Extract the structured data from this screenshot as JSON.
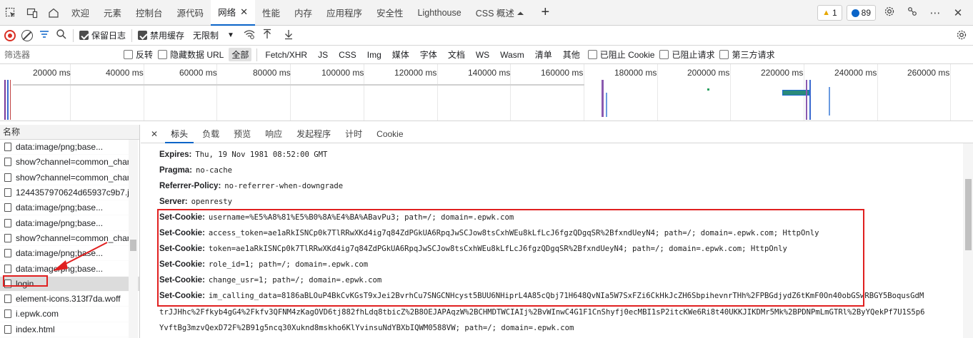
{
  "tabs": {
    "items": [
      {
        "label": "欢迎"
      },
      {
        "label": "元素"
      },
      {
        "label": "控制台"
      },
      {
        "label": "源代码"
      },
      {
        "label": "网络"
      },
      {
        "label": "性能"
      },
      {
        "label": "内存"
      },
      {
        "label": "应用程序"
      },
      {
        "label": "安全性"
      },
      {
        "label": "Lighthouse"
      },
      {
        "label": "CSS 概述 ⏶"
      }
    ],
    "active": "网络",
    "close_glyph": "✕",
    "plus_glyph": "+",
    "warnings": "1",
    "issues": "89"
  },
  "toolbar": {
    "preserve_log": "保留日志",
    "disable_cache": "禁用缓存",
    "throttle": "无限制"
  },
  "filter": {
    "placeholder": "筛选器",
    "invert": "反转",
    "hide_data_urls": "隐藏数据 URL",
    "types": [
      "全部",
      "Fetch/XHR",
      "JS",
      "CSS",
      "Img",
      "媒体",
      "字体",
      "文档",
      "WS",
      "Wasm",
      "清单",
      "其他"
    ],
    "blocked_cookies": "已阻止 Cookie",
    "blocked_requests": "已阻止请求",
    "third_party": "第三方请求"
  },
  "timeline": {
    "ticks": [
      "20000 ms",
      "40000 ms",
      "60000 ms",
      "80000 ms",
      "100000 ms",
      "120000 ms",
      "140000 ms",
      "160000 ms",
      "180000 ms",
      "200000 ms",
      "220000 ms",
      "240000 ms",
      "260000 ms"
    ]
  },
  "requests": {
    "header": "名称",
    "items": [
      {
        "name": "data:image/png;base..."
      },
      {
        "name": "show?channel=common_char"
      },
      {
        "name": "show?channel=common_char"
      },
      {
        "name": "1244357970624d65937c9b7.jp"
      },
      {
        "name": "data:image/png;base..."
      },
      {
        "name": "data:image/png;base..."
      },
      {
        "name": "show?channel=common_char"
      },
      {
        "name": "data:image/png;base..."
      },
      {
        "name": "data:image/png;base..."
      },
      {
        "name": "login"
      },
      {
        "name": "element-icons.313f7da.woff"
      },
      {
        "name": "i.epwk.com"
      },
      {
        "name": "index.html"
      }
    ]
  },
  "detail": {
    "tabs": [
      "标头",
      "负载",
      "预览",
      "响应",
      "发起程序",
      "计时",
      "Cookie"
    ],
    "active_tab": "标头",
    "headers": [
      {
        "name": "Expires:",
        "value": "Thu, 19 Nov 1981 08:52:00 GMT"
      },
      {
        "name": "Pragma:",
        "value": "no-cache"
      },
      {
        "name": "Referrer-Policy:",
        "value": "no-referrer-when-downgrade"
      },
      {
        "name": "Server:",
        "value": "openresty"
      },
      {
        "name": "Set-Cookie:",
        "value": "username=%E5%A8%81%E5%B0%8A%E4%BA%ABavPu3; path=/; domain=.epwk.com"
      },
      {
        "name": "Set-Cookie:",
        "value": "access_token=ae1aRkISNCp0k7TlRRwXKd4ig7q84ZdPGkUA6RpqJwSCJow8tsCxhWEu8kLfLcJ6fgzQDgqSR%2BfxndUeyN4; path=/; domain=.epwk.com; HttpOnly"
      },
      {
        "name": "Set-Cookie:",
        "value": "token=ae1aRkISNCp0k7TlRRwXKd4ig7q84ZdPGkUA6RpqJwSCJow8tsCxhWEu8kLfLcJ6fgzQDgqSR%2BfxndUeyN4; path=/; domain=.epwk.com; HttpOnly"
      },
      {
        "name": "Set-Cookie:",
        "value": "role_id=1; path=/; domain=.epwk.com"
      },
      {
        "name": "Set-Cookie:",
        "value": "change_usr=1; path=/; domain=.epwk.com"
      },
      {
        "name": "Set-Cookie:",
        "value": "im_calling_data=8186aBLOuP4BkCvKGsT9xJei2BvrhCu7SNGCNHcyst5BUU6NHiprL4A85cQbj71H648QvNIa5W7SxFZi6CkHkJcZH6SbpihevnrTHh%2FPBGdjydZ6tKmF0On40obGSwRBGY5BoqusGdM"
      }
    ],
    "continuation": [
      "trJJHhc%2Ffkyb4gG4%2Fkfv3QFNM4zKagOVD6tj882fhLdq8tbicZ%2B8OEJAPAqzW%2BCHMDTWCIAIj%2BvWInwC4G1F1CnShyfj0ecMBI1sP2itcKWe6Ri8t40UKKJIKDMr5Mk%2BPDNPmLmGTRl%2ByYQekPf7U1S5p6",
      "YvftBg3mzvQexD72F%2B91g5ncq30Xuknd8mskho6KlYvinsuNdYBXbIQWM0588VW; path=/; domain=.epwk.com"
    ]
  }
}
